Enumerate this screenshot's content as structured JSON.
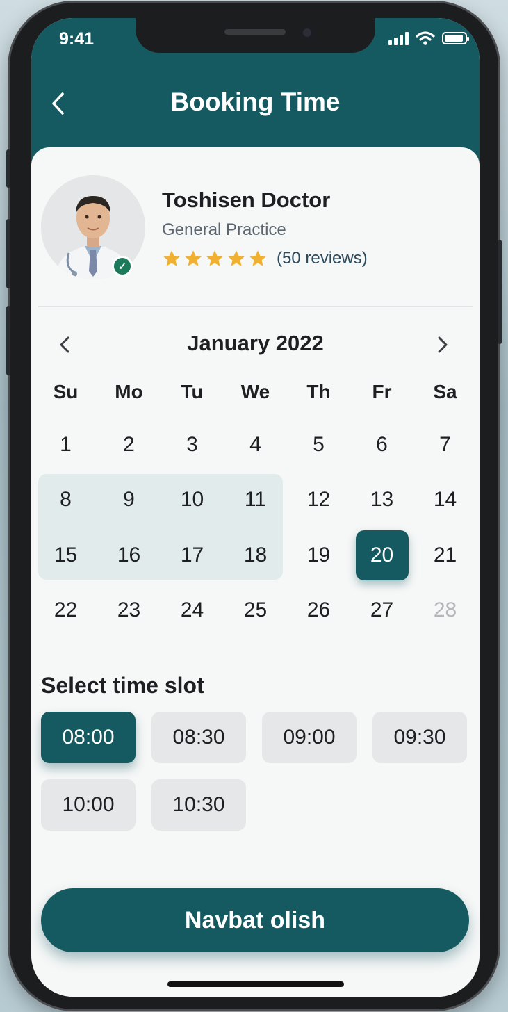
{
  "status_bar": {
    "time": "9:41"
  },
  "header": {
    "title": "Booking Time"
  },
  "doctor": {
    "name": "Toshisen Doctor",
    "specialty": "General Practice",
    "rating": 5,
    "reviews": "(50 reviews)"
  },
  "calendar": {
    "month": "January 2022",
    "weekdays": [
      "Su",
      "Mo",
      "Tu",
      "We",
      "Th",
      "Fr",
      "Sa"
    ],
    "days": [
      "1",
      "2",
      "3",
      "4",
      "5",
      "6",
      "7",
      "8",
      "9",
      "10",
      "11",
      "12",
      "13",
      "14",
      "15",
      "16",
      "17",
      "18",
      "19",
      "20",
      "21",
      "22",
      "23",
      "24",
      "25",
      "26",
      "27",
      "28"
    ],
    "selected_day": "20",
    "highlighted_days": [
      "8",
      "9",
      "10",
      "11",
      "15",
      "16",
      "17",
      "18"
    ],
    "muted_days": [
      "28"
    ]
  },
  "time_slots": {
    "title": "Select time slot",
    "slots": [
      "08:00",
      "08:30",
      "09:00",
      "09:30",
      "10:00",
      "10:30"
    ],
    "selected": "08:00"
  },
  "cta": {
    "label": "Navbat olish"
  },
  "colors": {
    "primary": "#155a60",
    "star": "#f0b132",
    "highlight": "#e1ebec"
  }
}
